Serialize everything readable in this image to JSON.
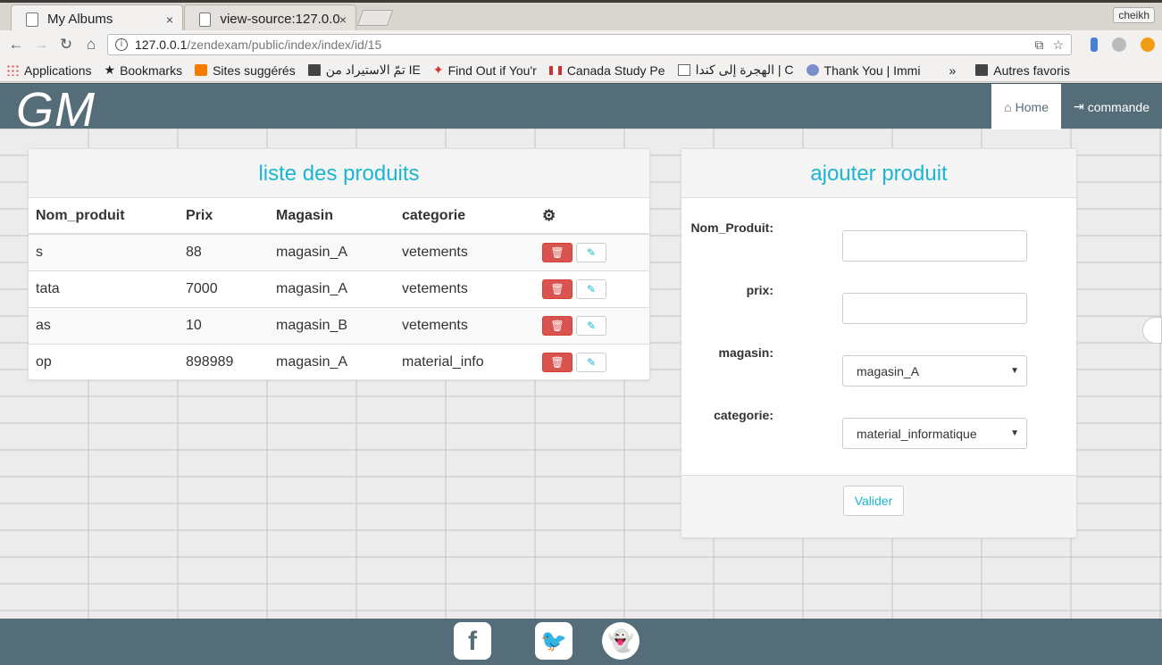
{
  "browser": {
    "tabs": [
      {
        "title": "My Albums",
        "close": "×"
      },
      {
        "title": "view-source:127.0.0",
        "close": "×"
      }
    ],
    "user": "cheikh",
    "address": {
      "host": "127.0.0.1",
      "path": "/zendexam/public/index/index/id/15"
    },
    "bookmarks": [
      "Applications",
      "Bookmarks",
      "Sites suggérés",
      "تمّ الاستيراد من IE",
      "Find Out if You'r",
      "Canada Study Pe",
      "الهجرة إلى كندا | C",
      "Thank You | Immi"
    ],
    "bookmarks_more": "»",
    "bookmarks_other": "Autres favoris"
  },
  "nav": {
    "brand": "GM",
    "links": [
      {
        "label": "Home",
        "icon": "home-icon"
      },
      {
        "label": "commande",
        "icon": "sign-in-icon"
      }
    ]
  },
  "list": {
    "title": "liste des produits",
    "headers": [
      "Nom_produit",
      "Prix",
      "Magasin",
      "categorie"
    ],
    "rows": [
      {
        "nom": "s",
        "prix": "88",
        "magasin": "magasin_A",
        "categorie": "vetements"
      },
      {
        "nom": "tata",
        "prix": "7000",
        "magasin": "magasin_A",
        "categorie": "vetements"
      },
      {
        "nom": "as",
        "prix": "10",
        "magasin": "magasin_B",
        "categorie": "vetements"
      },
      {
        "nom": "op",
        "prix": "898989",
        "magasin": "magasin_A",
        "categorie": "material_info"
      }
    ]
  },
  "form": {
    "title": "ajouter produit",
    "fields": {
      "nom_label": "Nom_Produit:",
      "nom_value": "",
      "prix_label": "prix:",
      "prix_value": "",
      "magasin_label": "magasin:",
      "magasin_value": "magasin_A",
      "categorie_label": "categorie:",
      "categorie_value": "material_informatique"
    },
    "submit": "Valider"
  },
  "footer": {
    "social": [
      "facebook-icon",
      "twitter-icon",
      "snapchat-icon"
    ]
  }
}
